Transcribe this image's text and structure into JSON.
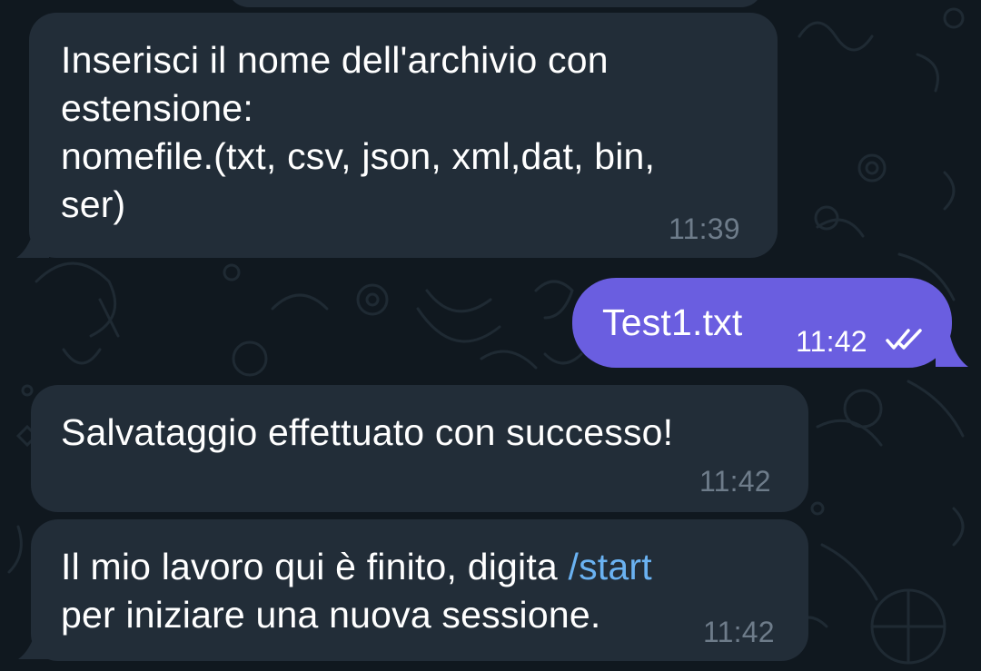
{
  "chat": {
    "messages": [
      {
        "direction": "incoming",
        "lines": [
          "Inserisci il nome dell'archivio con",
          "estensione:",
          "nomefile.(txt, csv, json, xml,dat, bin,",
          "ser)"
        ],
        "time": "11:39"
      },
      {
        "direction": "outgoing",
        "text": "Test1.txt",
        "time": "11:42",
        "status": "read"
      },
      {
        "direction": "incoming",
        "text": "Salvataggio effettuato con successo!",
        "time": "11:42"
      },
      {
        "direction": "incoming",
        "line1_before_link": "Il mio lavoro qui è finito, digita ",
        "command_link": "/start",
        "line2": "per iniziare una nuova sessione.",
        "time": "11:42"
      }
    ]
  },
  "colors": {
    "background": "#10181f",
    "incoming_bubble": "#222d38",
    "outgoing_bubble": "#6a5ee0",
    "link": "#6ab2f2",
    "timestamp": "#6e7c8a"
  },
  "icons": {
    "read_status": "double-check-icon"
  }
}
